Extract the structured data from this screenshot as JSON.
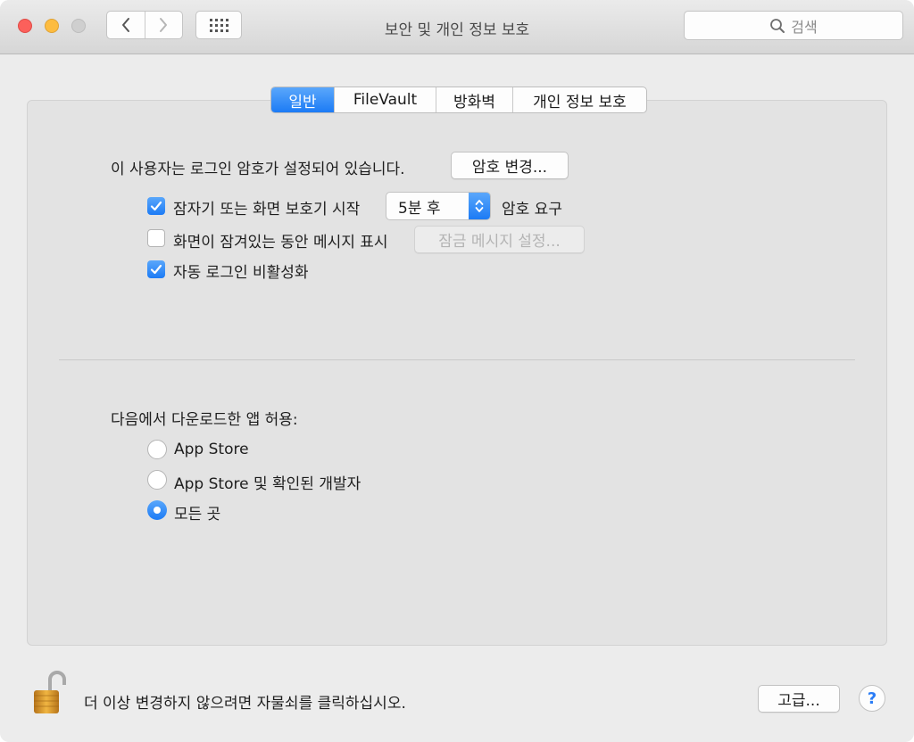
{
  "window": {
    "title": "보안 및 개인 정보 보호",
    "search_placeholder": "검색"
  },
  "tabs": [
    {
      "label": "일반",
      "active": true
    },
    {
      "label": "FileVault",
      "active": false
    },
    {
      "label": "방화벽",
      "active": false
    },
    {
      "label": "개인 정보 보호",
      "active": false
    }
  ],
  "general": {
    "password_text": "이 사용자는 로그인 암호가 설정되어 있습니다.",
    "change_password_label": "암호 변경...",
    "require_password": {
      "label": "잠자기 또는 화면 보호기 시작",
      "checked": true
    },
    "delay_select_value": "5분 후",
    "require_password_suffix": "암호 요구",
    "lock_message": {
      "label": "화면이 잠겨있는 동안 메시지 표시",
      "checked": false
    },
    "lock_message_button": "잠금 메시지 설정...",
    "disable_auto_login": {
      "label": "자동 로그인 비활성화",
      "checked": true
    }
  },
  "downloads": {
    "heading": "다음에서 다운로드한 앱 허용:",
    "options": [
      {
        "label": "App Store",
        "selected": false
      },
      {
        "label": "App Store 및 확인된 개발자",
        "selected": false
      },
      {
        "label": "모든 곳",
        "selected": true
      }
    ]
  },
  "footer": {
    "lock_text": "더 이상 변경하지 않으려면 자물쇠를 클릭하십시오.",
    "advanced_label": "고급...",
    "help_label": "?"
  },
  "colors": {
    "accent": "#1c7bf5",
    "lock_gold": "#d99a2b"
  }
}
